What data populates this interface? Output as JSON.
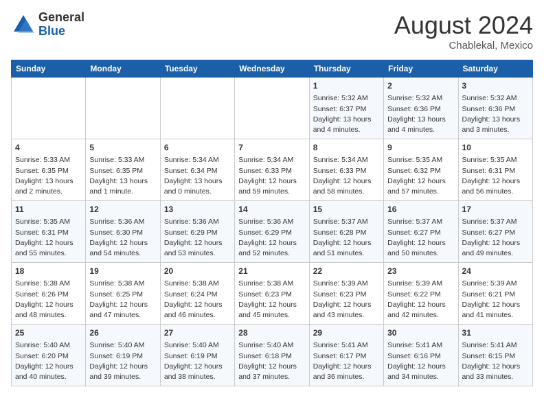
{
  "header": {
    "logo_general": "General",
    "logo_blue": "Blue",
    "month_year": "August 2024",
    "location": "Chablekal, Mexico"
  },
  "weekdays": [
    "Sunday",
    "Monday",
    "Tuesday",
    "Wednesday",
    "Thursday",
    "Friday",
    "Saturday"
  ],
  "weeks": [
    [
      {
        "day": "",
        "info": ""
      },
      {
        "day": "",
        "info": ""
      },
      {
        "day": "",
        "info": ""
      },
      {
        "day": "",
        "info": ""
      },
      {
        "day": "1",
        "info": "Sunrise: 5:32 AM\nSunset: 6:37 PM\nDaylight: 13 hours and 4 minutes."
      },
      {
        "day": "2",
        "info": "Sunrise: 5:32 AM\nSunset: 6:36 PM\nDaylight: 13 hours and 4 minutes."
      },
      {
        "day": "3",
        "info": "Sunrise: 5:32 AM\nSunset: 6:36 PM\nDaylight: 13 hours and 3 minutes."
      }
    ],
    [
      {
        "day": "4",
        "info": "Sunrise: 5:33 AM\nSunset: 6:35 PM\nDaylight: 13 hours and 2 minutes."
      },
      {
        "day": "5",
        "info": "Sunrise: 5:33 AM\nSunset: 6:35 PM\nDaylight: 13 hours and 1 minute."
      },
      {
        "day": "6",
        "info": "Sunrise: 5:34 AM\nSunset: 6:34 PM\nDaylight: 13 hours and 0 minutes."
      },
      {
        "day": "7",
        "info": "Sunrise: 5:34 AM\nSunset: 6:33 PM\nDaylight: 12 hours and 59 minutes."
      },
      {
        "day": "8",
        "info": "Sunrise: 5:34 AM\nSunset: 6:33 PM\nDaylight: 12 hours and 58 minutes."
      },
      {
        "day": "9",
        "info": "Sunrise: 5:35 AM\nSunset: 6:32 PM\nDaylight: 12 hours and 57 minutes."
      },
      {
        "day": "10",
        "info": "Sunrise: 5:35 AM\nSunset: 6:31 PM\nDaylight: 12 hours and 56 minutes."
      }
    ],
    [
      {
        "day": "11",
        "info": "Sunrise: 5:35 AM\nSunset: 6:31 PM\nDaylight: 12 hours and 55 minutes."
      },
      {
        "day": "12",
        "info": "Sunrise: 5:36 AM\nSunset: 6:30 PM\nDaylight: 12 hours and 54 minutes."
      },
      {
        "day": "13",
        "info": "Sunrise: 5:36 AM\nSunset: 6:29 PM\nDaylight: 12 hours and 53 minutes."
      },
      {
        "day": "14",
        "info": "Sunrise: 5:36 AM\nSunset: 6:29 PM\nDaylight: 12 hours and 52 minutes."
      },
      {
        "day": "15",
        "info": "Sunrise: 5:37 AM\nSunset: 6:28 PM\nDaylight: 12 hours and 51 minutes."
      },
      {
        "day": "16",
        "info": "Sunrise: 5:37 AM\nSunset: 6:27 PM\nDaylight: 12 hours and 50 minutes."
      },
      {
        "day": "17",
        "info": "Sunrise: 5:37 AM\nSunset: 6:27 PM\nDaylight: 12 hours and 49 minutes."
      }
    ],
    [
      {
        "day": "18",
        "info": "Sunrise: 5:38 AM\nSunset: 6:26 PM\nDaylight: 12 hours and 48 minutes."
      },
      {
        "day": "19",
        "info": "Sunrise: 5:38 AM\nSunset: 6:25 PM\nDaylight: 12 hours and 47 minutes."
      },
      {
        "day": "20",
        "info": "Sunrise: 5:38 AM\nSunset: 6:24 PM\nDaylight: 12 hours and 46 minutes."
      },
      {
        "day": "21",
        "info": "Sunrise: 5:38 AM\nSunset: 6:23 PM\nDaylight: 12 hours and 45 minutes."
      },
      {
        "day": "22",
        "info": "Sunrise: 5:39 AM\nSunset: 6:23 PM\nDaylight: 12 hours and 43 minutes."
      },
      {
        "day": "23",
        "info": "Sunrise: 5:39 AM\nSunset: 6:22 PM\nDaylight: 12 hours and 42 minutes."
      },
      {
        "day": "24",
        "info": "Sunrise: 5:39 AM\nSunset: 6:21 PM\nDaylight: 12 hours and 41 minutes."
      }
    ],
    [
      {
        "day": "25",
        "info": "Sunrise: 5:40 AM\nSunset: 6:20 PM\nDaylight: 12 hours and 40 minutes."
      },
      {
        "day": "26",
        "info": "Sunrise: 5:40 AM\nSunset: 6:19 PM\nDaylight: 12 hours and 39 minutes."
      },
      {
        "day": "27",
        "info": "Sunrise: 5:40 AM\nSunset: 6:19 PM\nDaylight: 12 hours and 38 minutes."
      },
      {
        "day": "28",
        "info": "Sunrise: 5:40 AM\nSunset: 6:18 PM\nDaylight: 12 hours and 37 minutes."
      },
      {
        "day": "29",
        "info": "Sunrise: 5:41 AM\nSunset: 6:17 PM\nDaylight: 12 hours and 36 minutes."
      },
      {
        "day": "30",
        "info": "Sunrise: 5:41 AM\nSunset: 6:16 PM\nDaylight: 12 hours and 34 minutes."
      },
      {
        "day": "31",
        "info": "Sunrise: 5:41 AM\nSunset: 6:15 PM\nDaylight: 12 hours and 33 minutes."
      }
    ]
  ]
}
